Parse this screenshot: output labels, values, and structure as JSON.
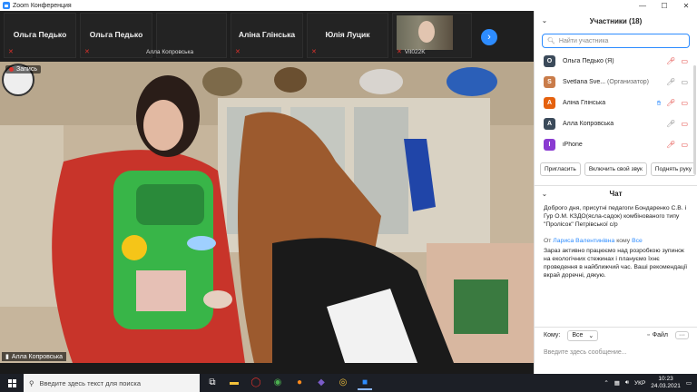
{
  "window": {
    "title": "Zoom Конференция",
    "buttons": {
      "minimize": "—",
      "maximize": "☐",
      "close": "✕"
    }
  },
  "strip": {
    "tiles": [
      {
        "name": "Ольга Педько"
      },
      {
        "name": "",
        "footer": "Алла Копровська"
      },
      {
        "name": "Аліна Глінська"
      },
      {
        "name": "Юлія Луцик"
      },
      {
        "name": "",
        "footer": "Vit022K"
      }
    ],
    "next_icon": "›"
  },
  "video": {
    "recording_label": "Запись",
    "speaker_name": "Алла Копровська"
  },
  "participants": {
    "title": "Участники (18)",
    "search_placeholder": "Найти участника",
    "items": [
      {
        "initial": "О",
        "name": "Ольга Педько (Я)",
        "role": "",
        "color": "#3b4a5a"
      },
      {
        "initial": "S",
        "name": "Svetlana Sve...",
        "role": "(Организатор)",
        "color": "#c97c4a"
      },
      {
        "initial": "А",
        "name": "Аліна Глінська",
        "role": "",
        "color": "#e5610e"
      },
      {
        "initial": "А",
        "name": "Алла Копровська",
        "role": "",
        "color": "#3b4a5a"
      },
      {
        "initial": "I",
        "name": "iPhone",
        "role": "",
        "color": "#8a3bd1"
      }
    ],
    "buttons": {
      "invite": "Пригласить",
      "unmute": "Включить свой звук",
      "raise_hand": "Поднять руку"
    }
  },
  "chat": {
    "title": "Чат",
    "message1": "Доброго дня, присутні педагоги Бондаренко С.В. і Гур О.М. КЗДО(ясла-садок) комбінованого типу \"Пролісок\" Петрівської с/р",
    "from_prefix": "От",
    "from_name": "Лариса Валентинівна",
    "to_prefix": "кому",
    "to_name": "Все",
    "message2": "Зараз активно працюємо над розробкою зупинок на екологічних стежинах і плануємо їхнє проведення в найближчий час. Ваші рекомендації вкрай доречні, дякую.",
    "to_label": "Кому:",
    "to_value": "Все",
    "file_label": "Файл",
    "more_label": "···",
    "input_placeholder": "Введите здесь сообщение..."
  },
  "taskbar": {
    "search_placeholder": "Введите здесь текст для поиска",
    "lang": "УКР",
    "time": "10:23",
    "date": "24.03.2021"
  }
}
